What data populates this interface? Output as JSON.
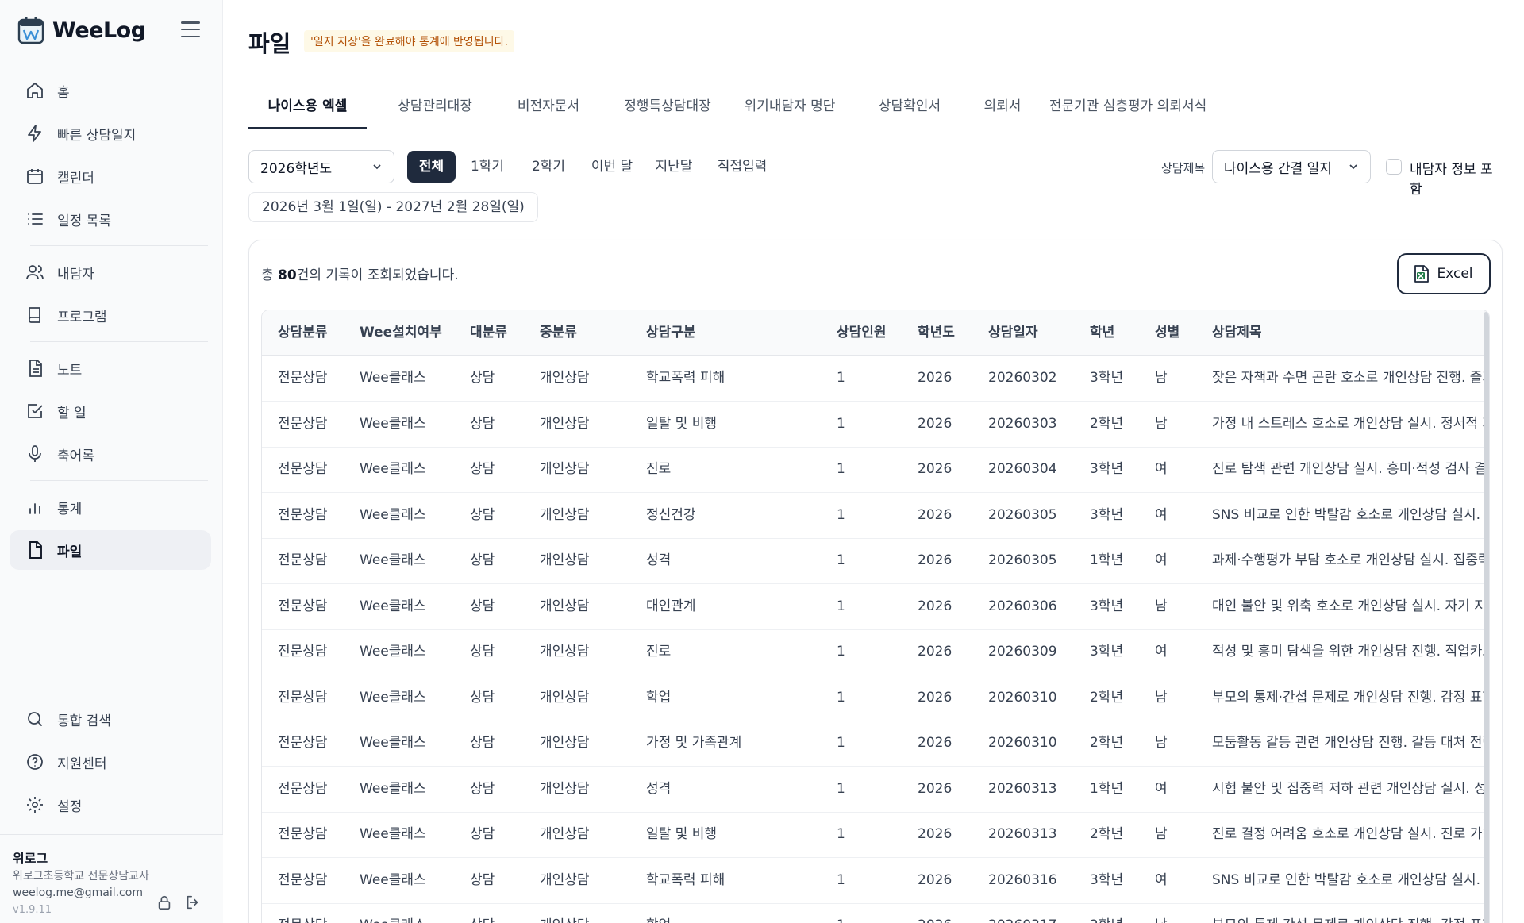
{
  "app": {
    "name": "WeeLog"
  },
  "sidebar": {
    "nav": [
      {
        "key": "home",
        "label": "홈",
        "icon": "home-icon"
      },
      {
        "key": "quick",
        "label": "빠른 상담일지",
        "icon": "lightning-icon"
      },
      {
        "key": "calendar",
        "label": "캘린더",
        "icon": "calendar-icon"
      },
      {
        "key": "schedule",
        "label": "일정 목록",
        "icon": "list-icon"
      },
      {
        "key": "client",
        "label": "내담자",
        "icon": "users-icon"
      },
      {
        "key": "program",
        "label": "프로그램",
        "icon": "book-icon"
      },
      {
        "key": "note",
        "label": "노트",
        "icon": "note-icon"
      },
      {
        "key": "todo",
        "label": "할 일",
        "icon": "checkbox-icon"
      },
      {
        "key": "transcript",
        "label": "축어록",
        "icon": "mic-icon"
      },
      {
        "key": "stats",
        "label": "통계",
        "icon": "bar-chart-icon"
      },
      {
        "key": "files",
        "label": "파일",
        "icon": "file-icon"
      },
      {
        "key": "search",
        "label": "통합 검색",
        "icon": "search-icon"
      },
      {
        "key": "support",
        "label": "지원센터",
        "icon": "help-icon"
      },
      {
        "key": "settings",
        "label": "설정",
        "icon": "gear-icon"
      }
    ],
    "user": {
      "name": "위로그",
      "role": "위로그초등학교 전문상담교사",
      "email": "weelog.me@gmail.com",
      "version": "v1.9.11"
    }
  },
  "page": {
    "title": "파일",
    "notice": "'일지 저장'을 완료해야 통계에 반영됩니다."
  },
  "tabs": [
    "나이스용 엑셀",
    "상담관리대장",
    "비전자문서",
    "정행특상담대장",
    "위기내담자 명단",
    "상담확인서",
    "의뢰서",
    "전문기관 심층평가 의뢰서식"
  ],
  "filters": {
    "year": "2026학년도",
    "periods": [
      "전체",
      "1학기",
      "2학기",
      "이번 달",
      "지난달",
      "직접입력"
    ],
    "title_label": "상담제목",
    "title_select": "나이스용 간결 일지",
    "include_label": "내담자 정보 포함",
    "date_range": "2026년 3월 1일(일) - 2027년 2월 28일(일)"
  },
  "summary": {
    "prefix": "총 ",
    "count": "80",
    "suffix": "건의 기록이 조회되었습니다."
  },
  "excel_label": "Excel",
  "table": {
    "headers": [
      "상담분류",
      "Wee설치여부",
      "대분류",
      "중분류",
      "상담구분",
      "상담인원",
      "학년도",
      "상담일자",
      "학년",
      "성별",
      "상담제목"
    ],
    "rows": [
      [
        "전문상담",
        "Wee클래스",
        "상담",
        "개인상담",
        "학교폭력 피해",
        "1",
        "2026",
        "20260302",
        "3학년",
        "남",
        "잦은 자책과 수면 곤란 호소로 개인상담 진행. 즐거운"
      ],
      [
        "전문상담",
        "Wee클래스",
        "상담",
        "개인상담",
        "일탈 및 비행",
        "1",
        "2026",
        "20260303",
        "2학년",
        "남",
        "가정 내 스트레스 호소로 개인상담 실시. 정서적 지지"
      ],
      [
        "전문상담",
        "Wee클래스",
        "상담",
        "개인상담",
        "진로",
        "1",
        "2026",
        "20260304",
        "3학년",
        "여",
        "진로 탐색 관련 개인상담 실시. 흥미·적성 검사 결과를"
      ],
      [
        "전문상담",
        "Wee클래스",
        "상담",
        "개인상담",
        "정신건강",
        "1",
        "2026",
        "20260305",
        "3학년",
        "여",
        "SNS 비교로 인한 박탈감 호소로 개인상담 실시. 사용"
      ],
      [
        "전문상담",
        "Wee클래스",
        "상담",
        "개인상담",
        "성격",
        "1",
        "2026",
        "20260305",
        "1학년",
        "여",
        "과제·수행평가 부담 호소로 개인상담 실시. 집중력 향"
      ],
      [
        "전문상담",
        "Wee클래스",
        "상담",
        "개인상담",
        "대인관계",
        "1",
        "2026",
        "20260306",
        "3학년",
        "남",
        "대인 불안 및 위축 호소로 개인상담 실시. 자기 지비 -"
      ],
      [
        "전문상담",
        "Wee클래스",
        "상담",
        "개인상담",
        "진로",
        "1",
        "2026",
        "20260309",
        "3학년",
        "여",
        "적성 및 흥미 탐색을 위한 개인상담 진행. 직업카드 분"
      ],
      [
        "전문상담",
        "Wee클래스",
        "상담",
        "개인상담",
        "학업",
        "1",
        "2026",
        "20260310",
        "2학년",
        "남",
        "부모의 통제·간섭 문제로 개인상담 진행. 감정 표현 및"
      ],
      [
        "전문상담",
        "Wee클래스",
        "상담",
        "개인상담",
        "가정 및 가족관계",
        "1",
        "2026",
        "20260310",
        "2학년",
        "남",
        "모둠활동 갈등 관련 개인상담 진행. 갈등 대처 전략 수"
      ],
      [
        "전문상담",
        "Wee클래스",
        "상담",
        "개인상담",
        "성격",
        "1",
        "2026",
        "20260313",
        "1학년",
        "여",
        "시험 불안 및 집중력 저하 관련 개인상담 실시. 성취 -"
      ],
      [
        "전문상담",
        "Wee클래스",
        "상담",
        "개인상담",
        "일탈 및 비행",
        "1",
        "2026",
        "20260313",
        "2학년",
        "남",
        "진로 결정 어려움 호소로 개인상담 실시. 진로 가치 및"
      ],
      [
        "전문상담",
        "Wee클래스",
        "상담",
        "개인상담",
        "학교폭력 피해",
        "1",
        "2026",
        "20260316",
        "3학년",
        "여",
        "SNS 비교로 인한 박탈감 호소로 개인상담 실시. 가정"
      ],
      [
        "전문상담",
        "Wee클래스",
        "상담",
        "개인상담",
        "학업",
        "1",
        "2026",
        "20260317",
        "2학년",
        "남",
        "부모의 통제·간섭 문제로 개인상담 진행. 감정 표현 및"
      ]
    ]
  },
  "colors": {
    "primary": "#1f2a3d",
    "notice_text": "#b45309",
    "active_nav_bg": "#eef0f4"
  }
}
